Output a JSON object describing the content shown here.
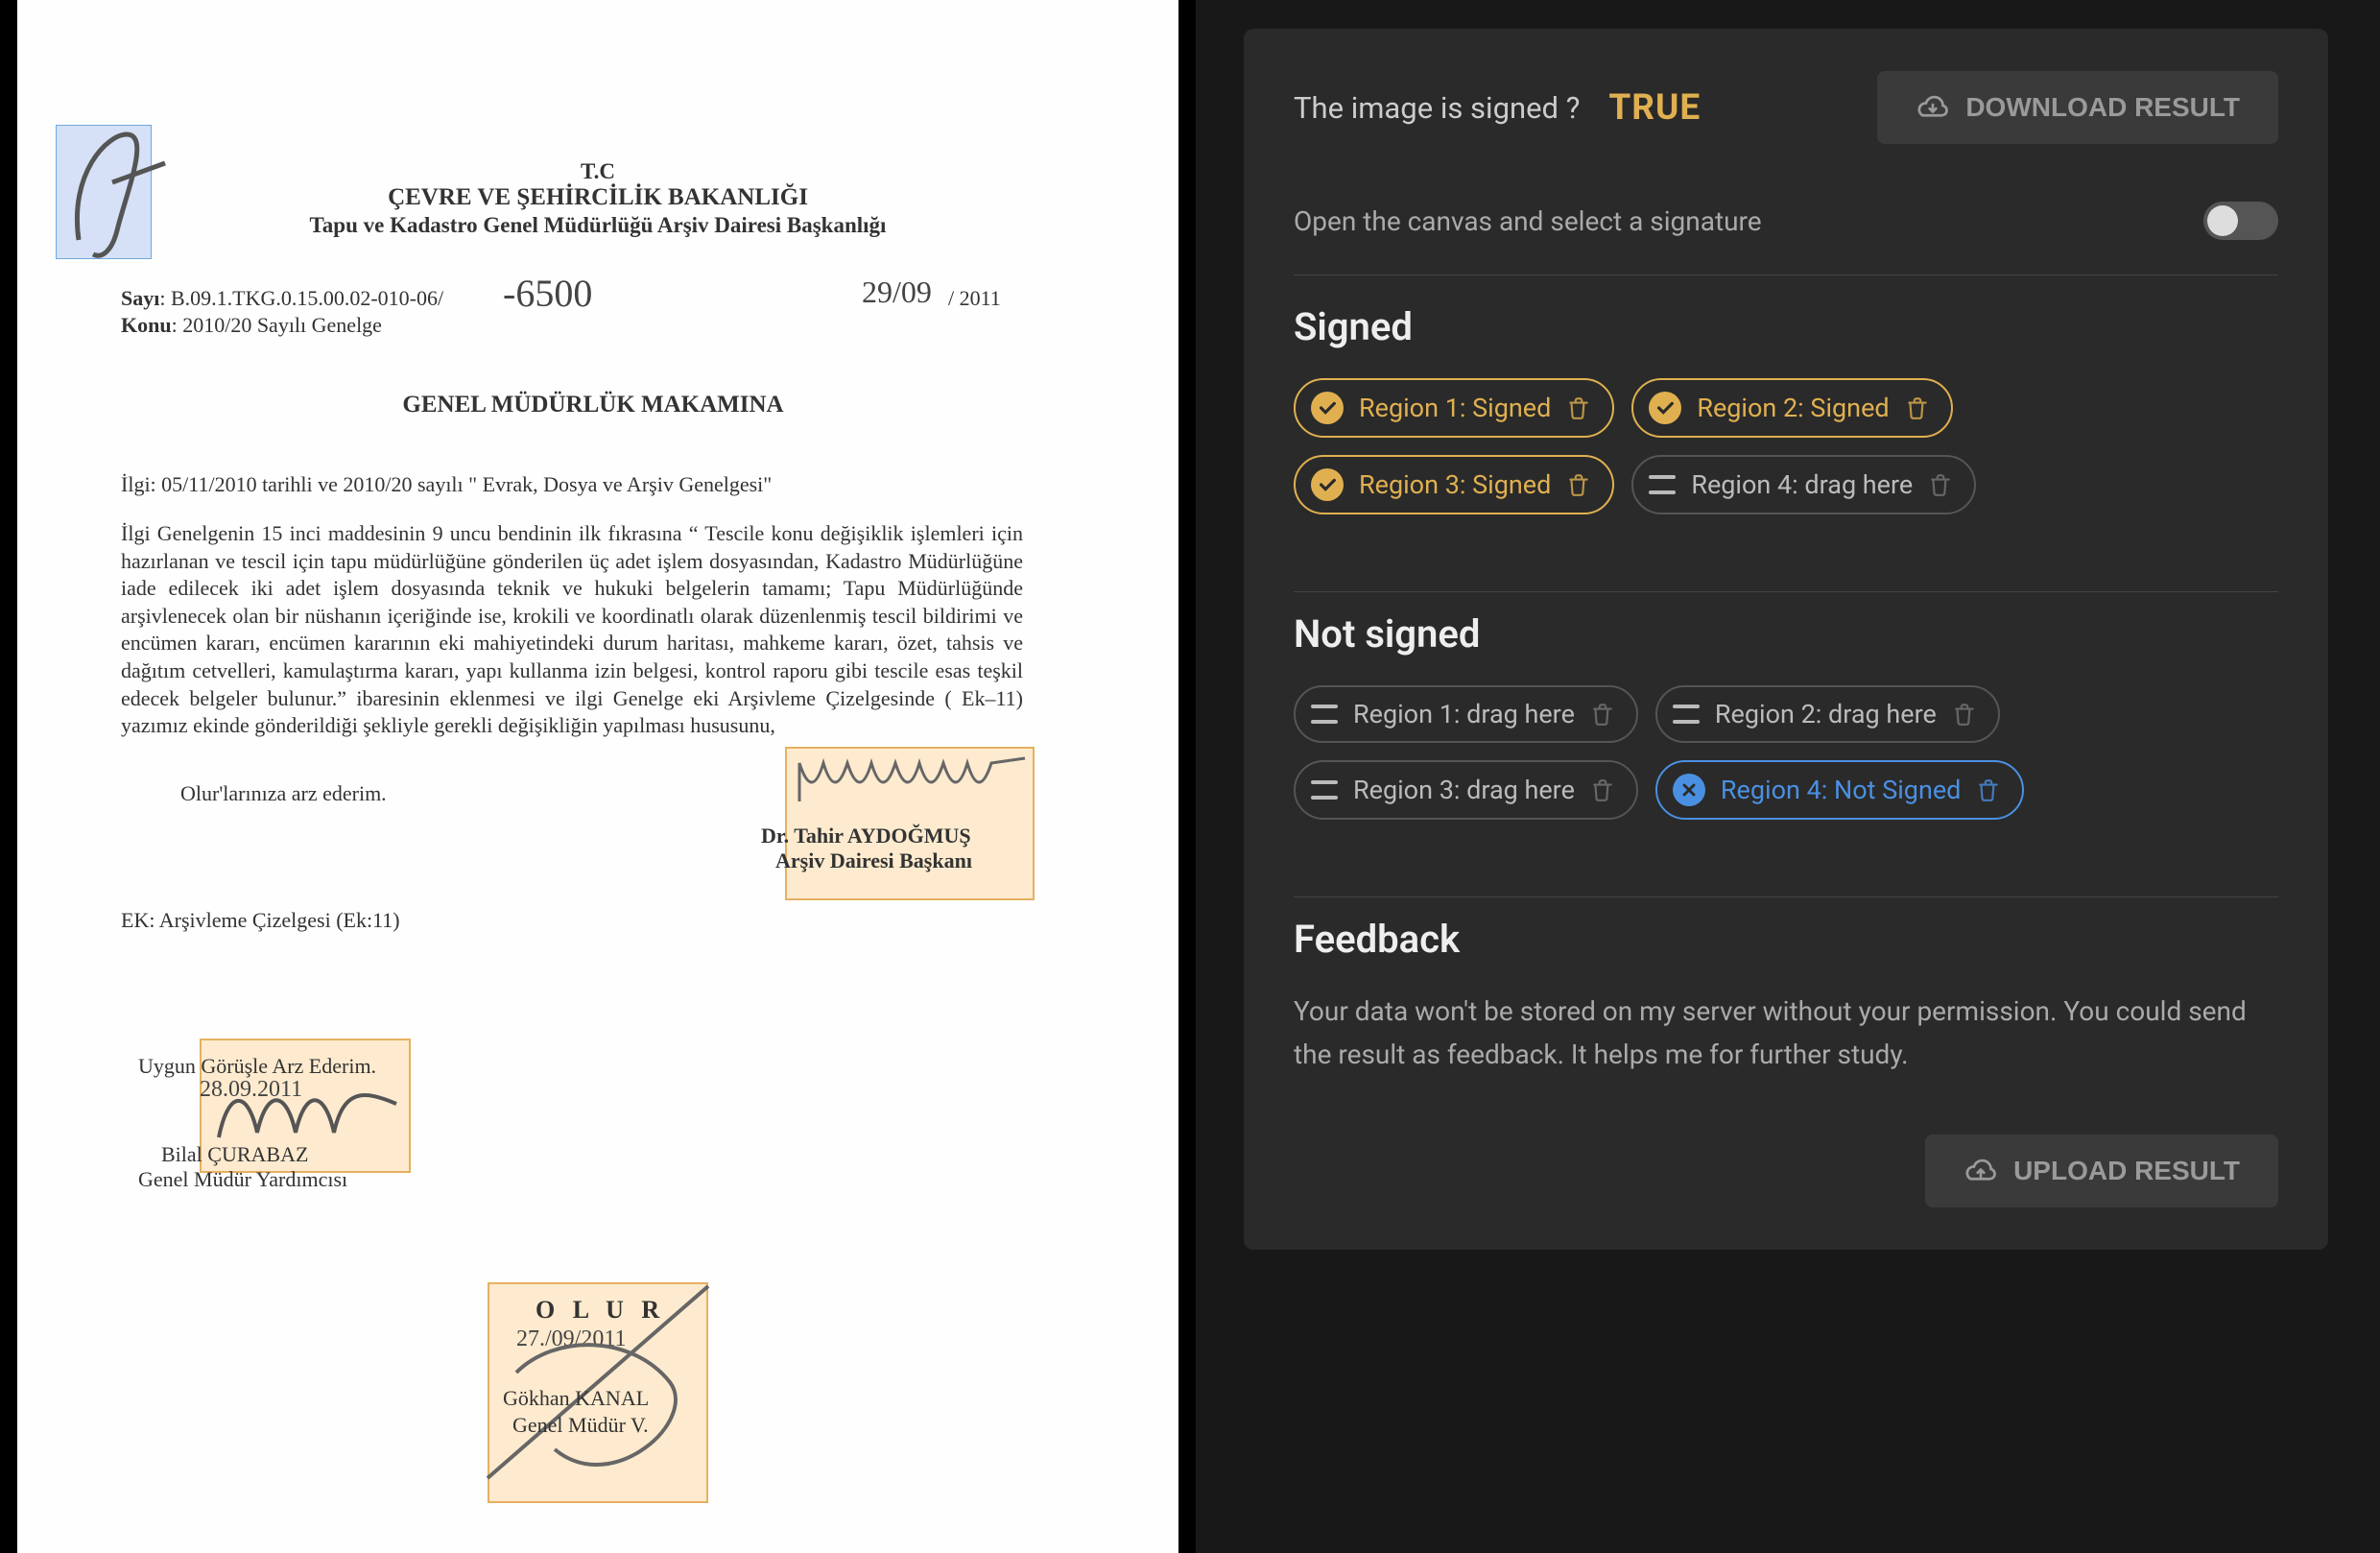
{
  "status": {
    "question": "The image is signed ?",
    "value": "TRUE"
  },
  "download_button": "DOWNLOAD RESULT",
  "upload_button": "UPLOAD RESULT",
  "canvas_toggle": {
    "label": "Open the canvas and select a signature",
    "on": false
  },
  "signed": {
    "title": "Signed",
    "chips": [
      {
        "label": "Region 1: Signed",
        "state": "signed"
      },
      {
        "label": "Region 2: Signed",
        "state": "signed"
      },
      {
        "label": "Region 3: Signed",
        "state": "signed"
      },
      {
        "label": "Region 4: drag here",
        "state": "empty"
      }
    ]
  },
  "not_signed": {
    "title": "Not signed",
    "chips": [
      {
        "label": "Region 1: drag here",
        "state": "empty"
      },
      {
        "label": "Region 2: drag here",
        "state": "empty"
      },
      {
        "label": "Region 3: drag here",
        "state": "empty"
      },
      {
        "label": "Region 4: Not Signed",
        "state": "notsigned"
      }
    ]
  },
  "feedback": {
    "title": "Feedback",
    "body": "Your data won't be stored on my server without your permission. You could send the result as feedback. It helps me for further study."
  },
  "document": {
    "header_tc": "T.C",
    "header_ministry": "ÇEVRE VE ŞEHİRCİLİK BAKANLIĞI",
    "header_dept": "Tapu ve Kadastro Genel Müdürlüğü Arşiv Dairesi Başkanlığı",
    "sayi_label": "Sayı",
    "sayi_value": ": B.09.1.TKG.0.15.00.02-010-06/",
    "sayi_handwritten": "-6500",
    "date_handwritten": "29/09",
    "date_printed": "/ 2011",
    "konu_label": "Konu",
    "konu_value": ": 2010/20 Sayılı Genelge",
    "recipient": "GENEL MÜDÜRLÜK MAKAMINA",
    "ilgi": "İlgi: 05/11/2010 tarihli ve 2010/20 sayılı \" Evrak, Dosya ve Arşiv Genelgesi\"",
    "body": "İlgi Genelgenin 15 inci maddesinin 9 uncu bendinin ilk fıkrasına  “ Tescile konu değişiklik işlemleri için hazırlanan ve tescil için tapu müdürlüğüne gönderilen üç adet işlem dosyasından, Kadastro Müdürlüğüne iade edilecek iki adet işlem dosyasında teknik ve hukuki belgelerin tamamı; Tapu Müdürlüğünde arşivlenecek olan bir nüshanın içeriğinde ise, krokili ve koordinatlı olarak düzenlenmiş tescil bildirimi ve encümen kararı, encümen kararının eki mahiyetindeki durum haritası, mahkeme kararı, özet, tahsis ve dağıtım cetvelleri, kamulaştırma kararı, yapı kullanma izin belgesi, kontrol raporu gibi tescile esas teşkil edecek belgeler bulunur.” ibaresinin eklenmesi ve ilgi Genelge eki Arşivleme Çizelgesinde ( Ek–11) yazımız ekinde gönderildiği şekliyle gerekli değişikliğin yapılması hususunu,",
    "closing": "Olur'larınıza arz ederim.",
    "sig1_name": "Dr. Tahir AYDOĞMUŞ",
    "sig1_title": "Arşiv Dairesi Başkanı",
    "ek": "EK: Arşivleme Çizelgesi (Ek:11)",
    "sig2_line1": "Uygun Görüşle Arz Ederim.",
    "sig2_date": "28.09.2011",
    "sig2_name": "Bilal ÇURABAZ",
    "sig2_title": "Genel Müdür Yardımcısı",
    "sig3_olur": "O L U R",
    "sig3_date": "27./09/2011",
    "sig3_name": "Gökhan KANAL",
    "sig3_title": "Genel Müdür V."
  }
}
